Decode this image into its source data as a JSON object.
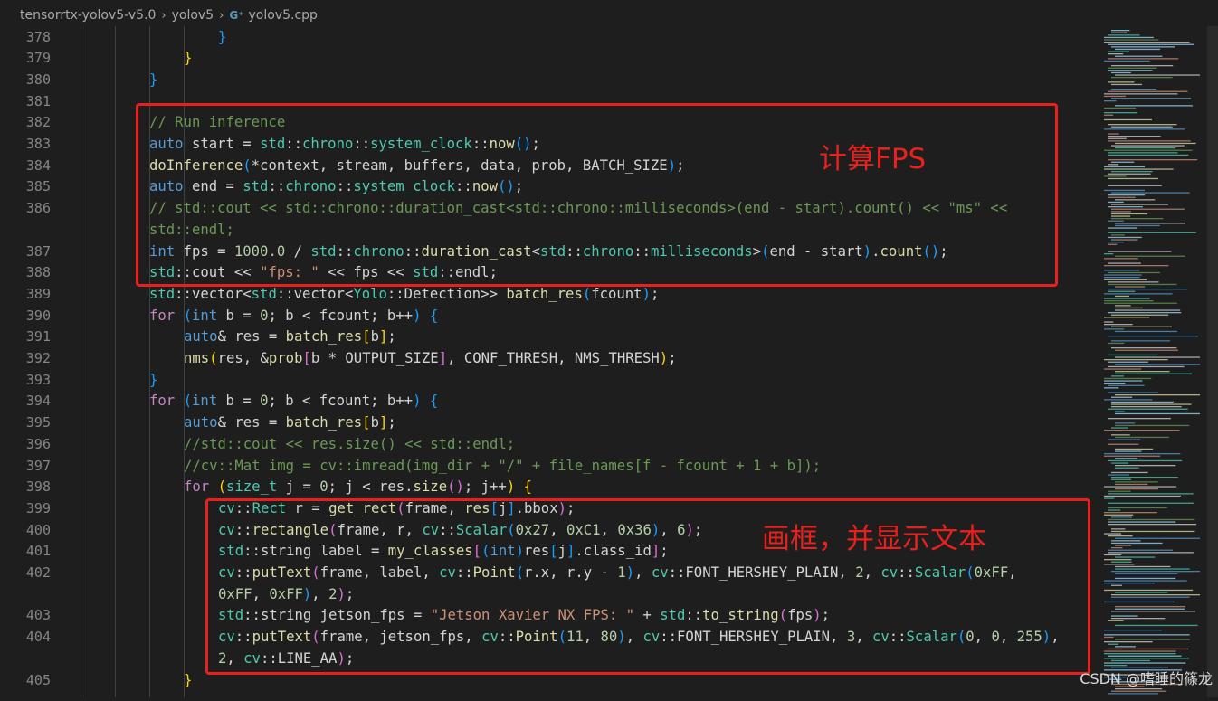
{
  "breadcrumb": {
    "folder": "tensorrtx-yolov5-v5.0",
    "subfolder": "yolov5",
    "file_icon": "C++ file icon (G⁺)",
    "file": "yolov5.cpp"
  },
  "colors": {
    "background": "#1e1e1e",
    "annotation_red": "#e8211d",
    "keyword": "#569cd6",
    "control": "#c586c0",
    "function": "#dcdcaa",
    "type": "#4ec9b0",
    "variable": "#9cdcfe",
    "number": "#b5cea8",
    "string": "#ce9178",
    "comment": "#6a9955"
  },
  "lines": [
    {
      "num": "378",
      "indent": 2,
      "tokens": [
        [
          "b3",
          "}"
        ]
      ]
    },
    {
      "num": "379",
      "indent": 1,
      "tokens": [
        [
          "b1",
          "}"
        ]
      ]
    },
    {
      "num": "380",
      "indent": 0,
      "tokens": [
        [
          "b3",
          "}"
        ]
      ]
    },
    {
      "num": "381",
      "indent": 0,
      "tokens": []
    },
    {
      "num": "382",
      "indent": 0,
      "tokens": [
        [
          "com",
          "// Run inference"
        ]
      ]
    },
    {
      "num": "383",
      "indent": 0,
      "tokens": [
        [
          "kw",
          "auto"
        ],
        [
          "p",
          " start = "
        ],
        [
          "ty",
          "std"
        ],
        [
          "p",
          "::"
        ],
        [
          "ty",
          "chrono"
        ],
        [
          "p",
          "::"
        ],
        [
          "ty",
          "system_clock"
        ],
        [
          "p",
          "::"
        ],
        [
          "fn",
          "now"
        ],
        [
          "b3",
          "()"
        ],
        [
          "p",
          ";"
        ]
      ]
    },
    {
      "num": "384",
      "indent": 0,
      "tokens": [
        [
          "fn",
          "doInference"
        ],
        [
          "b3",
          "("
        ],
        [
          "p",
          "*context, stream, buffers, data, prob, BATCH_SIZE"
        ],
        [
          "b3",
          ")"
        ],
        [
          "p",
          ";"
        ]
      ]
    },
    {
      "num": "385",
      "indent": 0,
      "tokens": [
        [
          "kw",
          "auto"
        ],
        [
          "p",
          " end = "
        ],
        [
          "ty",
          "std"
        ],
        [
          "p",
          "::"
        ],
        [
          "ty",
          "chrono"
        ],
        [
          "p",
          "::"
        ],
        [
          "ty",
          "system_clock"
        ],
        [
          "p",
          "::"
        ],
        [
          "fn",
          "now"
        ],
        [
          "b3",
          "()"
        ],
        [
          "p",
          ";"
        ]
      ]
    },
    {
      "num": "386",
      "indent": 0,
      "tokens": [
        [
          "com",
          "// std::cout << std::chrono::duration_cast<std::chrono::milliseconds>(end - start).count() << \"ms\" <<"
        ]
      ]
    },
    {
      "num": "",
      "indent": 0,
      "tokens": [
        [
          "com",
          "std::endl;"
        ]
      ]
    },
    {
      "num": "387",
      "indent": 0,
      "tokens": [
        [
          "kw",
          "int"
        ],
        [
          "p",
          " fps = "
        ],
        [
          "num",
          "1000.0"
        ],
        [
          "p",
          " / "
        ],
        [
          "ty",
          "std"
        ],
        [
          "p",
          "::"
        ],
        [
          "ty",
          "chrono"
        ],
        [
          "p",
          "::"
        ],
        [
          "fn",
          "duration_cast"
        ],
        [
          "p",
          "<"
        ],
        [
          "ty",
          "std"
        ],
        [
          "p",
          "::"
        ],
        [
          "ty",
          "chrono"
        ],
        [
          "p",
          "::"
        ],
        [
          "ty",
          "milliseconds"
        ],
        [
          "p",
          ">"
        ],
        [
          "b3",
          "("
        ],
        [
          "p",
          "end - start"
        ],
        [
          "b3",
          ")"
        ],
        [
          "p",
          "."
        ],
        [
          "fn",
          "count"
        ],
        [
          "b3",
          "()"
        ],
        [
          "p",
          ";"
        ]
      ]
    },
    {
      "num": "388",
      "indent": 0,
      "tokens": [
        [
          "ty",
          "std"
        ],
        [
          "p",
          "::cout << "
        ],
        [
          "str",
          "\"fps: \""
        ],
        [
          "p",
          " << fps << "
        ],
        [
          "ty",
          "std"
        ],
        [
          "p",
          "::endl;"
        ]
      ]
    },
    {
      "num": "389",
      "indent": 0,
      "tokens": [
        [
          "ty",
          "std"
        ],
        [
          "p",
          "::vector<"
        ],
        [
          "ty",
          "std"
        ],
        [
          "p",
          "::vector<"
        ],
        [
          "ty",
          "Yolo"
        ],
        [
          "p",
          "::Detection>> "
        ],
        [
          "fn",
          "batch_res"
        ],
        [
          "b3",
          "("
        ],
        [
          "p",
          "fcount"
        ],
        [
          "b3",
          ")"
        ],
        [
          "p",
          ";"
        ]
      ]
    },
    {
      "num": "390",
      "indent": 0,
      "tokens": [
        [
          "ctl",
          "for"
        ],
        [
          "p",
          " "
        ],
        [
          "b3",
          "("
        ],
        [
          "kw",
          "int"
        ],
        [
          "p",
          " b = "
        ],
        [
          "num",
          "0"
        ],
        [
          "p",
          "; b < fcount; b++"
        ],
        [
          "b3",
          ")"
        ],
        [
          "p",
          " "
        ],
        [
          "b3",
          "{"
        ]
      ]
    },
    {
      "num": "391",
      "indent": 1,
      "tokens": [
        [
          "kw",
          "auto"
        ],
        [
          "p",
          "& res = "
        ],
        [
          "fn",
          "batch_res"
        ],
        [
          "b1",
          "["
        ],
        [
          "p",
          "b"
        ],
        [
          "b1",
          "]"
        ],
        [
          "p",
          ";"
        ]
      ]
    },
    {
      "num": "392",
      "indent": 1,
      "tokens": [
        [
          "fn",
          "nms"
        ],
        [
          "b1",
          "("
        ],
        [
          "p",
          "res, &"
        ],
        [
          "fn",
          "prob"
        ],
        [
          "b2",
          "["
        ],
        [
          "p",
          "b * OUTPUT_SIZE"
        ],
        [
          "b2",
          "]"
        ],
        [
          "p",
          ", CONF_THRESH, NMS_THRESH"
        ],
        [
          "b1",
          ")"
        ],
        [
          "p",
          ";"
        ]
      ]
    },
    {
      "num": "393",
      "indent": 0,
      "tokens": [
        [
          "b3",
          "}"
        ]
      ]
    },
    {
      "num": "394",
      "indent": 0,
      "tokens": [
        [
          "ctl",
          "for"
        ],
        [
          "p",
          " "
        ],
        [
          "b3",
          "("
        ],
        [
          "kw",
          "int"
        ],
        [
          "p",
          " b = "
        ],
        [
          "num",
          "0"
        ],
        [
          "p",
          "; b < fcount; b++"
        ],
        [
          "b3",
          ")"
        ],
        [
          "p",
          " "
        ],
        [
          "b3",
          "{"
        ]
      ]
    },
    {
      "num": "395",
      "indent": 1,
      "tokens": [
        [
          "kw",
          "auto"
        ],
        [
          "p",
          "& res = "
        ],
        [
          "fn",
          "batch_res"
        ],
        [
          "b1",
          "["
        ],
        [
          "p",
          "b"
        ],
        [
          "b1",
          "]"
        ],
        [
          "p",
          ";"
        ]
      ]
    },
    {
      "num": "396",
      "indent": 1,
      "tokens": [
        [
          "com",
          "//std::cout << res.size() << std::endl;"
        ]
      ]
    },
    {
      "num": "397",
      "indent": 1,
      "tokens": [
        [
          "com",
          "//cv::Mat img = cv::imread(img_dir + \"/\" + file_names[f - fcount + 1 + b]);"
        ]
      ]
    },
    {
      "num": "398",
      "indent": 1,
      "tokens": [
        [
          "ctl",
          "for"
        ],
        [
          "p",
          " "
        ],
        [
          "b1",
          "("
        ],
        [
          "ty",
          "size_t"
        ],
        [
          "p",
          " j = "
        ],
        [
          "num",
          "0"
        ],
        [
          "p",
          "; j < res."
        ],
        [
          "fn",
          "size"
        ],
        [
          "b2",
          "()"
        ],
        [
          "p",
          "; j++"
        ],
        [
          "b1",
          ")"
        ],
        [
          "p",
          " "
        ],
        [
          "b1",
          "{"
        ]
      ]
    },
    {
      "num": "399",
      "indent": 2,
      "tokens": [
        [
          "ty",
          "cv"
        ],
        [
          "p",
          "::"
        ],
        [
          "ty",
          "Rect"
        ],
        [
          "p",
          " r = "
        ],
        [
          "fn",
          "get_rect"
        ],
        [
          "b2",
          "("
        ],
        [
          "p",
          "frame, "
        ],
        [
          "fn",
          "res"
        ],
        [
          "b3",
          "["
        ],
        [
          "p",
          "j"
        ],
        [
          "b3",
          "]"
        ],
        [
          "p",
          ".bbox"
        ],
        [
          "b2",
          ")"
        ],
        [
          "p",
          ";"
        ]
      ]
    },
    {
      "num": "400",
      "indent": 2,
      "tokens": [
        [
          "ty",
          "cv"
        ],
        [
          "p",
          "::"
        ],
        [
          "fn",
          "rectangle"
        ],
        [
          "b2",
          "("
        ],
        [
          "p",
          "frame, r, "
        ],
        [
          "ty",
          "cv"
        ],
        [
          "p",
          "::"
        ],
        [
          "ty",
          "Scalar"
        ],
        [
          "b3",
          "("
        ],
        [
          "num",
          "0x27"
        ],
        [
          "p",
          ", "
        ],
        [
          "num",
          "0xC1"
        ],
        [
          "p",
          ", "
        ],
        [
          "num",
          "0x36"
        ],
        [
          "b3",
          ")"
        ],
        [
          "p",
          ", "
        ],
        [
          "num",
          "6"
        ],
        [
          "b2",
          ")"
        ],
        [
          "p",
          ";"
        ]
      ]
    },
    {
      "num": "401",
      "indent": 2,
      "tokens": [
        [
          "ty",
          "std"
        ],
        [
          "p",
          "::string label = "
        ],
        [
          "fn",
          "my_classes"
        ],
        [
          "b2",
          "["
        ],
        [
          "b3",
          "("
        ],
        [
          "kw",
          "int"
        ],
        [
          "b3",
          ")"
        ],
        [
          "p",
          "res"
        ],
        [
          "b3",
          "["
        ],
        [
          "p",
          "j"
        ],
        [
          "b3",
          "]"
        ],
        [
          "p",
          ".class_id"
        ],
        [
          "b2",
          "]"
        ],
        [
          "p",
          ";"
        ]
      ]
    },
    {
      "num": "402",
      "indent": 2,
      "tokens": [
        [
          "ty",
          "cv"
        ],
        [
          "p",
          "::"
        ],
        [
          "fn",
          "putText"
        ],
        [
          "b2",
          "("
        ],
        [
          "p",
          "frame, label, "
        ],
        [
          "ty",
          "cv"
        ],
        [
          "p",
          "::"
        ],
        [
          "fn",
          "Point"
        ],
        [
          "b3",
          "("
        ],
        [
          "p",
          "r.x, r.y - "
        ],
        [
          "num",
          "1"
        ],
        [
          "b3",
          ")"
        ],
        [
          "p",
          ", "
        ],
        [
          "ty",
          "cv"
        ],
        [
          "p",
          "::FONT_HERSHEY_PLAIN, "
        ],
        [
          "num",
          "2"
        ],
        [
          "p",
          ", "
        ],
        [
          "ty",
          "cv"
        ],
        [
          "p",
          "::"
        ],
        [
          "ty",
          "Scalar"
        ],
        [
          "b3",
          "("
        ],
        [
          "num",
          "0xFF"
        ],
        [
          "p",
          ","
        ]
      ]
    },
    {
      "num": "",
      "indent": 2,
      "tokens": [
        [
          "num",
          "0xFF"
        ],
        [
          "p",
          ", "
        ],
        [
          "num",
          "0xFF"
        ],
        [
          "b3",
          ")"
        ],
        [
          "p",
          ", "
        ],
        [
          "num",
          "2"
        ],
        [
          "b2",
          ")"
        ],
        [
          "p",
          ";"
        ]
      ]
    },
    {
      "num": "403",
      "indent": 2,
      "tokens": [
        [
          "ty",
          "std"
        ],
        [
          "p",
          "::string jetson_fps = "
        ],
        [
          "str",
          "\"Jetson Xavier NX FPS: \""
        ],
        [
          "p",
          " + "
        ],
        [
          "ty",
          "std"
        ],
        [
          "p",
          "::"
        ],
        [
          "fn",
          "to_string"
        ],
        [
          "b2",
          "("
        ],
        [
          "p",
          "fps"
        ],
        [
          "b2",
          ")"
        ],
        [
          "p",
          ";"
        ]
      ]
    },
    {
      "num": "404",
      "indent": 2,
      "tokens": [
        [
          "ty",
          "cv"
        ],
        [
          "p",
          "::"
        ],
        [
          "fn",
          "putText"
        ],
        [
          "b2",
          "("
        ],
        [
          "p",
          "frame, jetson_fps, "
        ],
        [
          "ty",
          "cv"
        ],
        [
          "p",
          "::"
        ],
        [
          "fn",
          "Point"
        ],
        [
          "b3",
          "("
        ],
        [
          "num",
          "11"
        ],
        [
          "p",
          ", "
        ],
        [
          "num",
          "80"
        ],
        [
          "b3",
          ")"
        ],
        [
          "p",
          ", "
        ],
        [
          "ty",
          "cv"
        ],
        [
          "p",
          "::FONT_HERSHEY_PLAIN, "
        ],
        [
          "num",
          "3"
        ],
        [
          "p",
          ", "
        ],
        [
          "ty",
          "cv"
        ],
        [
          "p",
          "::"
        ],
        [
          "ty",
          "Scalar"
        ],
        [
          "b3",
          "("
        ],
        [
          "num",
          "0"
        ],
        [
          "p",
          ", "
        ],
        [
          "num",
          "0"
        ],
        [
          "p",
          ", "
        ],
        [
          "num",
          "255"
        ],
        [
          "b3",
          ")"
        ],
        [
          "p",
          ","
        ]
      ]
    },
    {
      "num": "",
      "indent": 2,
      "tokens": [
        [
          "num",
          "2"
        ],
        [
          "p",
          ", "
        ],
        [
          "ty",
          "cv"
        ],
        [
          "p",
          "::LINE_AA"
        ],
        [
          "b2",
          ")"
        ],
        [
          "p",
          ";"
        ]
      ]
    },
    {
      "num": "405",
      "indent": 1,
      "tokens": [
        [
          "b1",
          "}"
        ]
      ]
    }
  ],
  "annotations": {
    "fps_label": "计算FPS",
    "draw_label": "画框，并显示文本"
  },
  "watermark": "CSDN @嗜睡的篠龙"
}
